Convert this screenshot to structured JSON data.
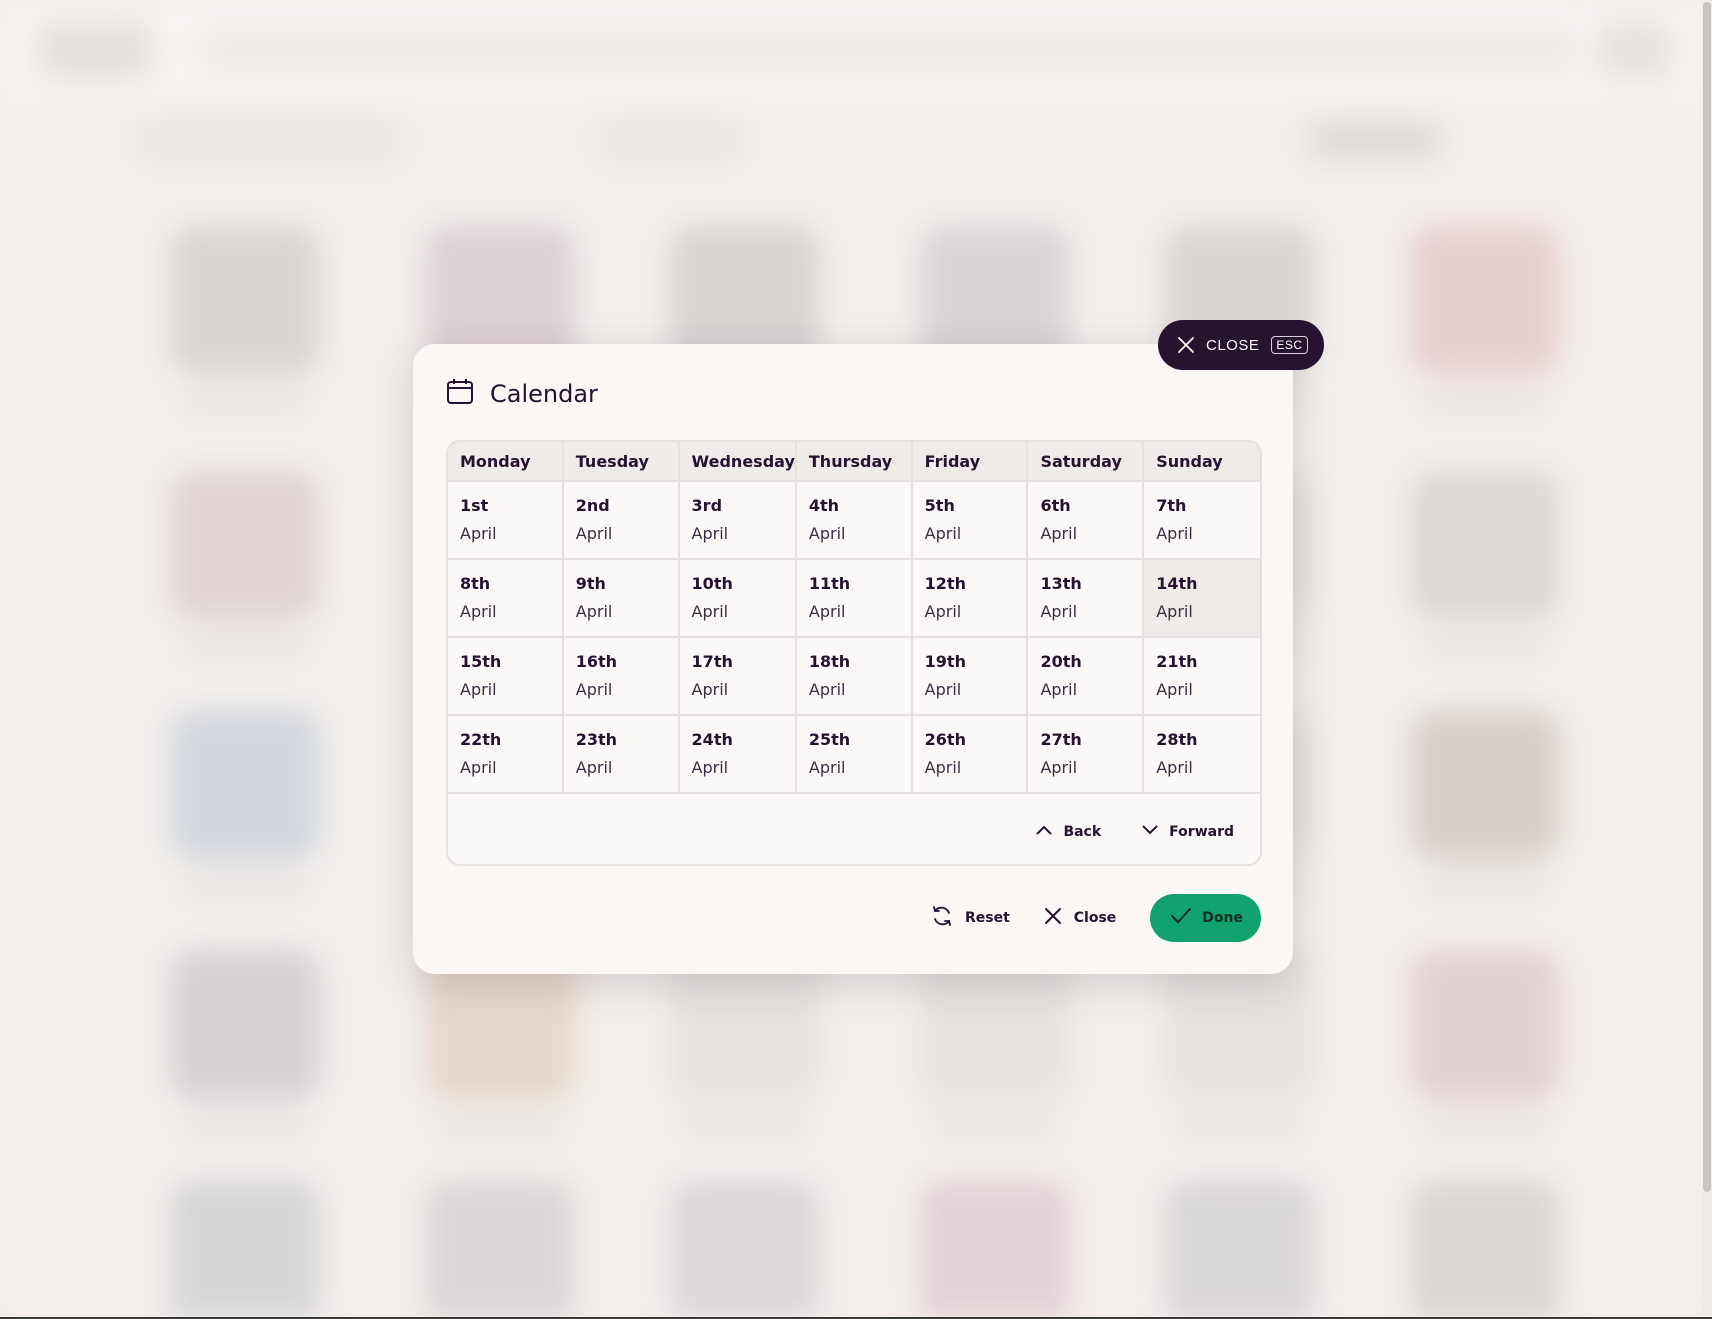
{
  "colors": {
    "primary_dark": "#25132f",
    "accent_green": "#12a26f",
    "modal_bg": "#faf7f4",
    "selected_cell_bg": "#efebe8"
  },
  "close_pill": {
    "label": "CLOSE",
    "shortcut": "ESC",
    "icon": "close-icon"
  },
  "modal": {
    "title": "Calendar",
    "title_icon": "calendar-icon"
  },
  "calendar": {
    "weekdays": [
      "Monday",
      "Tuesday",
      "Wednesday",
      "Thursday",
      "Friday",
      "Saturday",
      "Sunday"
    ],
    "selected_date": "14th",
    "weeks": [
      [
        {
          "day": "1st",
          "month": "April"
        },
        {
          "day": "2nd",
          "month": "April"
        },
        {
          "day": "3rd",
          "month": "April"
        },
        {
          "day": "4th",
          "month": "April"
        },
        {
          "day": "5th",
          "month": "April"
        },
        {
          "day": "6th",
          "month": "April"
        },
        {
          "day": "7th",
          "month": "April"
        }
      ],
      [
        {
          "day": "8th",
          "month": "April"
        },
        {
          "day": "9th",
          "month": "April"
        },
        {
          "day": "10th",
          "month": "April"
        },
        {
          "day": "11th",
          "month": "April"
        },
        {
          "day": "12th",
          "month": "April"
        },
        {
          "day": "13th",
          "month": "April"
        },
        {
          "day": "14th",
          "month": "April"
        }
      ],
      [
        {
          "day": "15th",
          "month": "April"
        },
        {
          "day": "16th",
          "month": "April"
        },
        {
          "day": "17th",
          "month": "April"
        },
        {
          "day": "18th",
          "month": "April"
        },
        {
          "day": "19th",
          "month": "April"
        },
        {
          "day": "20th",
          "month": "April"
        },
        {
          "day": "21th",
          "month": "April"
        }
      ],
      [
        {
          "day": "22th",
          "month": "April"
        },
        {
          "day": "23th",
          "month": "April"
        },
        {
          "day": "24th",
          "month": "April"
        },
        {
          "day": "25th",
          "month": "April"
        },
        {
          "day": "26th",
          "month": "April"
        },
        {
          "day": "27th",
          "month": "April"
        },
        {
          "day": "28th",
          "month": "April"
        }
      ]
    ],
    "nav": {
      "back_label": "Back",
      "back_icon": "chevron-up-icon",
      "forward_label": "Forward",
      "forward_icon": "chevron-down-icon"
    }
  },
  "actions": {
    "reset_label": "Reset",
    "reset_icon": "refresh-icon",
    "close_label": "Close",
    "close_icon": "close-icon",
    "done_label": "Done",
    "done_icon": "check-icon"
  }
}
